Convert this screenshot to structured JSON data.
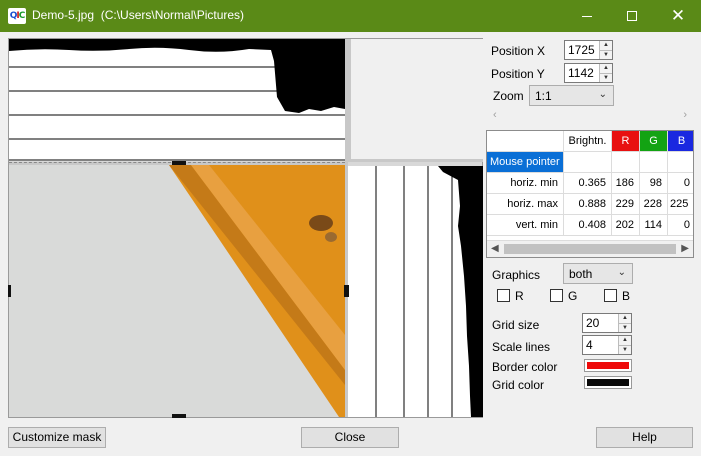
{
  "window": {
    "title": "Demo-5.jpg  (C:\\Users\\Normal\\Pictures)",
    "app_icon_letters": [
      "Q",
      "I",
      "C"
    ],
    "minimize_glyph": "—",
    "maximize_glyph": "☐",
    "close_glyph": "✕"
  },
  "position": {
    "x_label": "Position X",
    "x_value": "1725",
    "y_label": "Position Y",
    "y_value": "1142"
  },
  "zoom": {
    "label": "Zoom",
    "value": "1:1"
  },
  "table": {
    "headers": [
      "",
      "Brightn.",
      "R",
      "G",
      "B"
    ],
    "header_colors": {
      "R": "#e81010",
      "G": "#13a313",
      "B": "#1a28e0"
    },
    "section_label": "Mouse pointer",
    "section_color": "#0a6fd6",
    "rows": [
      {
        "label": "horiz. min",
        "brightness": "0.365",
        "r": "186",
        "g": "98",
        "b": "0"
      },
      {
        "label": "horiz. max",
        "brightness": "0.888",
        "r": "229",
        "g": "228",
        "b": "225"
      },
      {
        "label": "vert. min",
        "brightness": "0.408",
        "r": "202",
        "g": "114",
        "b": "0"
      }
    ]
  },
  "graphics": {
    "label": "Graphics",
    "value": "both",
    "channels": [
      {
        "label": "R",
        "checked": false
      },
      {
        "label": "G",
        "checked": false
      },
      {
        "label": "B",
        "checked": false
      }
    ]
  },
  "grid_settings": {
    "grid_size_label": "Grid size",
    "grid_size_value": "20",
    "scale_lines_label": "Scale lines",
    "scale_lines_value": "4",
    "border_color_label": "Border color",
    "border_color": "#ee0a0a",
    "grid_color_label": "Grid color",
    "grid_color": "#0a0a0a"
  },
  "buttons": {
    "customize": "Customize mask",
    "close": "Close",
    "help": "Help"
  },
  "colors": {
    "titlebar": "#5a8a17",
    "photo_paper": "#d9dad9",
    "photo_orange": "#e0901a"
  }
}
